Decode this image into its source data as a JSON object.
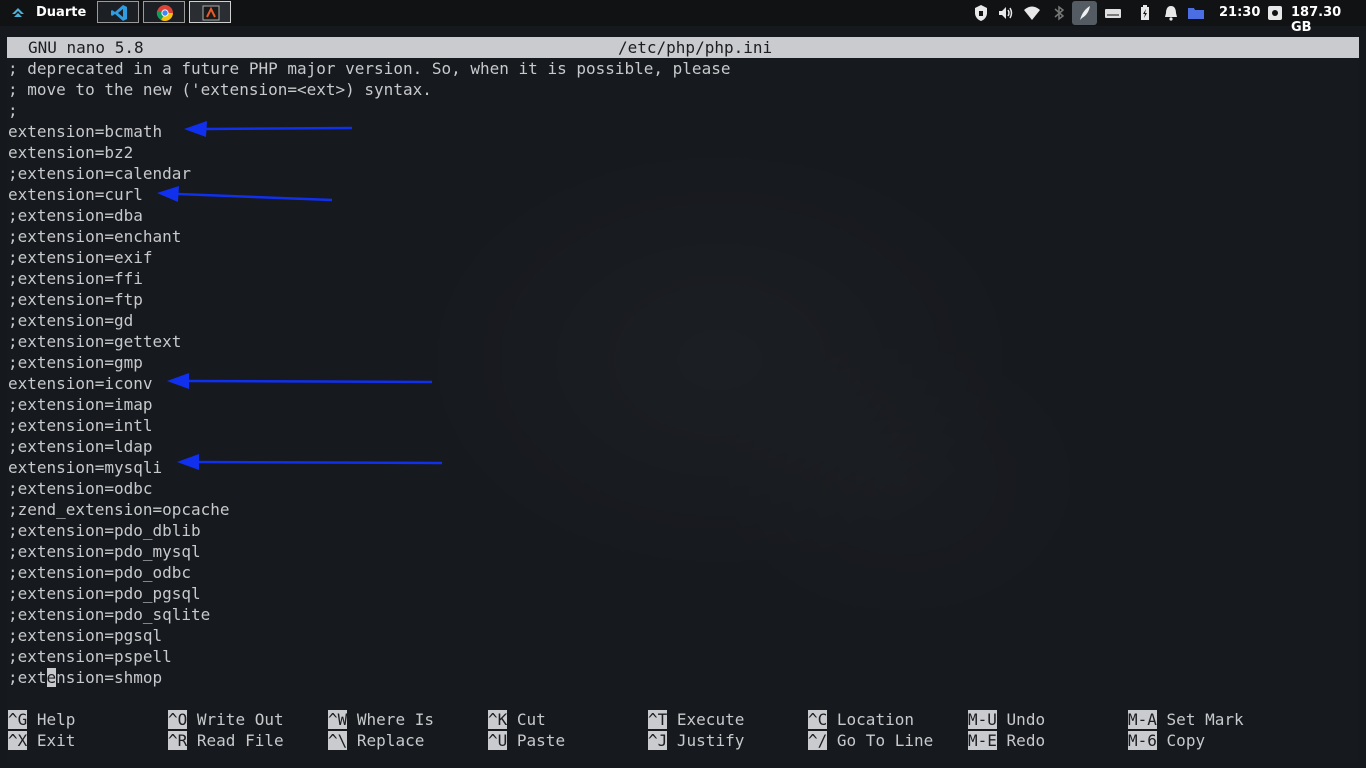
{
  "panel": {
    "user": "Duarte",
    "time": "21:30",
    "disk": "187.30 GB",
    "apps": [
      "vscode-icon",
      "chrome-icon",
      "terminal-icon"
    ]
  },
  "editor": {
    "app_version": "GNU nano 5.8",
    "file_path": "/etc/php/php.ini",
    "lines": [
      "; deprecated in a future PHP major version. So, when it is possible, please",
      "; move to the new ('extension=<ext>) syntax.",
      ";",
      "extension=bcmath",
      "extension=bz2",
      ";extension=calendar",
      "extension=curl",
      ";extension=dba",
      ";extension=enchant",
      ";extension=exif",
      ";extension=ffi",
      ";extension=ftp",
      ";extension=gd",
      ";extension=gettext",
      ";extension=gmp",
      "extension=iconv",
      ";extension=imap",
      ";extension=intl",
      ";extension=ldap",
      "extension=mysqli",
      ";extension=odbc",
      ";zend_extension=opcache",
      ";extension=pdo_dblib",
      ";extension=pdo_mysql",
      ";extension=pdo_odbc",
      ";extension=pdo_pgsql",
      ";extension=pdo_sqlite",
      ";extension=pgsql",
      ";extension=pspell"
    ],
    "cursor_line": {
      "before": ";ext",
      "cursor": "e",
      "after": "nsion=shmop"
    }
  },
  "shortcuts": [
    {
      "key": "^G",
      "label": "Help"
    },
    {
      "key": "^X",
      "label": "Exit"
    },
    {
      "key": "^O",
      "label": "Write Out"
    },
    {
      "key": "^R",
      "label": "Read File"
    },
    {
      "key": "^W",
      "label": "Where Is"
    },
    {
      "key": "^\\",
      "label": "Replace"
    },
    {
      "key": "^K",
      "label": "Cut"
    },
    {
      "key": "^U",
      "label": "Paste"
    },
    {
      "key": "^T",
      "label": "Execute"
    },
    {
      "key": "^J",
      "label": "Justify"
    },
    {
      "key": "^C",
      "label": "Location"
    },
    {
      "key": "^/",
      "label": "Go To Line"
    },
    {
      "key": "M-U",
      "label": "Undo"
    },
    {
      "key": "M-E",
      "label": "Redo"
    },
    {
      "key": "M-A",
      "label": "Set Mark"
    },
    {
      "key": "M-6",
      "label": "Copy"
    }
  ],
  "colors": {
    "arrow": "#1030ee",
    "text": "#c7c9cc",
    "titlebar": "#c9cbcf"
  }
}
